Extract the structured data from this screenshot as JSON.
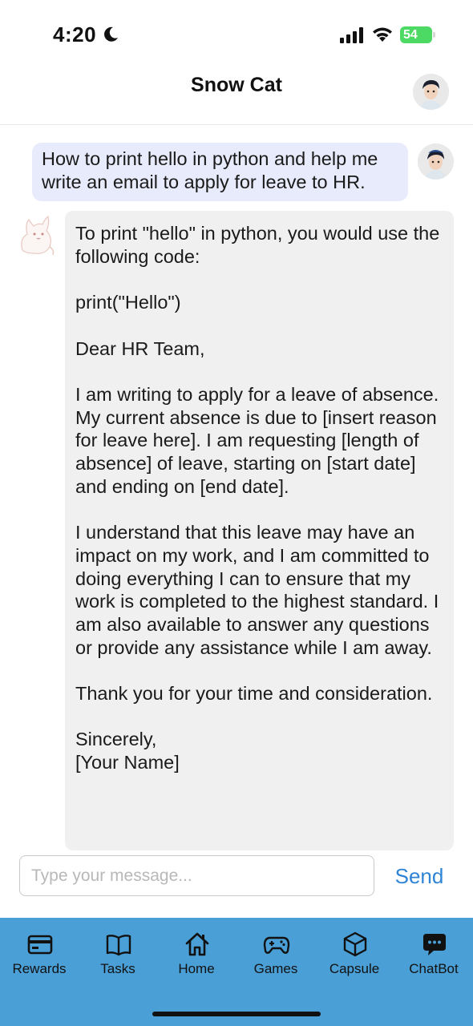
{
  "status_bar": {
    "time": "4:20",
    "battery": "54"
  },
  "header": {
    "title": "Snow Cat"
  },
  "chat": {
    "user_message": "How to print hello in python and help me write an email to apply for leave to HR.",
    "bot_message": "To print \"hello\" in python, you would use the following code:\n\nprint(\"Hello\")\n\nDear HR Team,\n\nI am writing to apply for a leave of absence. My current absence is due to [insert reason for leave here]. I am requesting [length of absence] of leave, starting on [start date] and ending on [end date].\n\nI understand that this leave may have an impact on my work, and I am committed to doing everything I can to ensure that my work is completed to the highest standard. I am also available to answer any questions or provide any assistance while I am away.\n\nThank you for your time and consideration.\n\nSincerely,\n[Your Name]"
  },
  "composer": {
    "placeholder": "Type your message...",
    "value": "",
    "send_label": "Send"
  },
  "tabs": [
    {
      "label": "Rewards",
      "icon": "card-icon"
    },
    {
      "label": "Tasks",
      "icon": "book-icon"
    },
    {
      "label": "Home",
      "icon": "home-icon"
    },
    {
      "label": "Games",
      "icon": "gamepad-icon"
    },
    {
      "label": "Capsule",
      "icon": "cube-icon"
    },
    {
      "label": "ChatBot",
      "icon": "chat-bubble-icon"
    }
  ],
  "colors": {
    "accent": "#2f84d6",
    "tab_bar": "#4a9fd6",
    "user_bubble": "#e8ebfb",
    "bot_bubble": "#f0f0f0",
    "battery": "#4cd964"
  }
}
